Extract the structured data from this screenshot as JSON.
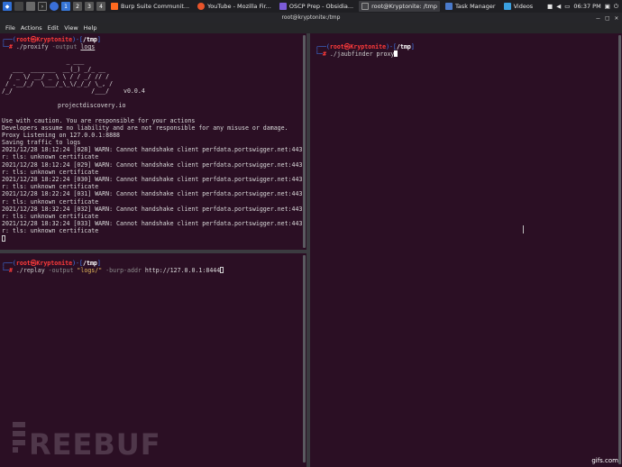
{
  "taskbar": {
    "tasks": [
      {
        "label": "Burp Suite Communit...",
        "color": "#ff6a1f",
        "active": false
      },
      {
        "label": "YouTube - Mozilla Fir...",
        "color": "#e8542a",
        "active": false
      },
      {
        "label": "OSCP Prep - Obsidia...",
        "color": "#7c5cd9",
        "active": false
      },
      {
        "label": "root@Kryptonite: /tmp",
        "color": "#444448",
        "active": true
      },
      {
        "label": "Task Manager",
        "color": "#4a7acb",
        "active": false
      },
      {
        "label": "Videos",
        "color": "#3aa0e0",
        "active": false
      }
    ],
    "time": "06:37 PM"
  },
  "window": {
    "title": "root@kryptonite:/tmp",
    "menu": [
      "File",
      "Actions",
      "Edit",
      "View",
      "Help"
    ]
  },
  "top_left": {
    "prompt_user": "root",
    "prompt_host": "Kryptonite",
    "prompt_dir": "/tmp",
    "command": "./proxify",
    "command_args_dim": " -output ",
    "command_arg": "logs",
    "ascii": [
      "                  _ ___",
      "   ___  _______  __(_) _/_ __",
      "  / _ \\/ __/ _ \\ \\ / / _/ // /",
      " / .__/_/  \\___/_\\_\\/_/_/ \\_, /",
      "/_/                      /___/    v0.0.4"
    ],
    "site": "projectdiscovery.io",
    "notice": [
      "Use with caution. You are responsible for your actions",
      "Developers assume no liability and are not responsible for any misuse or damage.",
      "Proxy Listening on 127.0.0.1:8888",
      "Saving traffic to logs"
    ],
    "log": [
      "2021/12/28 18:12:24 [028] WARN: Cannot handshake client perfdata.portswigger.net:443 r",
      "r: tls: unknown certificate",
      "2021/12/28 18:12:24 [029] WARN: Cannot handshake client perfdata.portswigger.net:443 r",
      "r: tls: unknown certificate",
      "2021/12/28 18:22:24 [030] WARN: Cannot handshake client perfdata.portswigger.net:443 r",
      "r: tls: unknown certificate",
      "2021/12/28 18:22:24 [031] WARN: Cannot handshake client perfdata.portswigger.net:443 r",
      "r: tls: unknown certificate",
      "2021/12/28 18:32:24 [032] WARN: Cannot handshake client perfdata.portswigger.net:443 r",
      "r: tls: unknown certificate",
      "2021/12/28 18:32:24 [033] WARN: Cannot handshake client perfdata.portswigger.net:443 r",
      "r: tls: unknown certificate"
    ]
  },
  "bottom_left": {
    "prompt_user": "root",
    "prompt_host": "Kryptonite",
    "prompt_dir": "/tmp",
    "command": "./replay",
    "arg1_dim": " -output ",
    "arg1": "\"logs/\"",
    "arg2_dim": " -burp-addr ",
    "arg2": "http://127.0.0.1:8444"
  },
  "right": {
    "prompt_user": "root",
    "prompt_host": "Kryptonite",
    "prompt_dir": "/tmp",
    "command": "./jaubfinder",
    "arg": " proxy"
  },
  "watermark": {
    "text": "REEBUF"
  },
  "badge": "gifs.com",
  "colors": {
    "terminal_bg": "#2b0f24",
    "prompt_blue": "#3f7df6",
    "prompt_red": "#ff3b3b"
  }
}
